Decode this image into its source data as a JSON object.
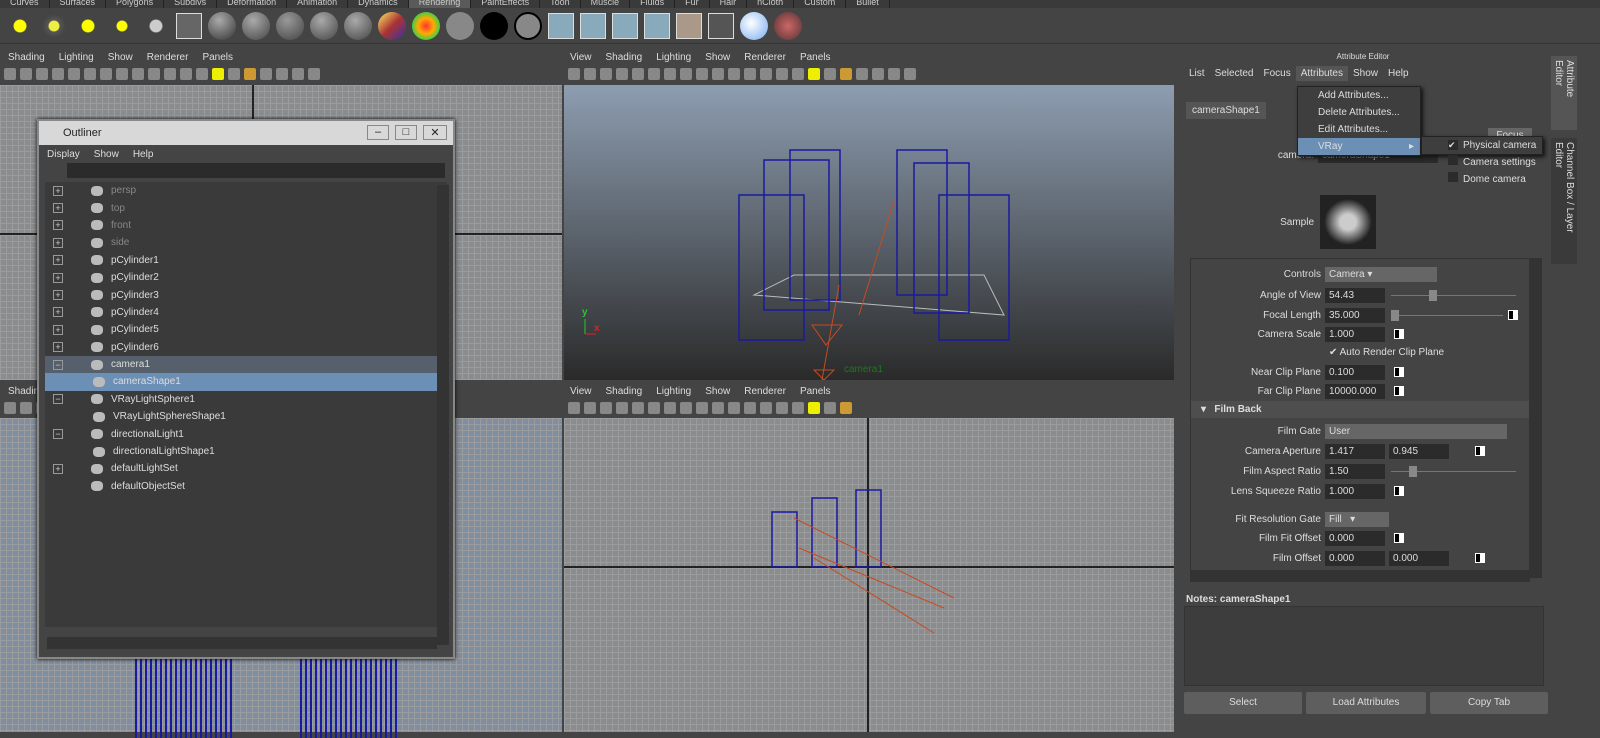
{
  "shelf_tabs": [
    "Curves",
    "Surfaces",
    "Polygons",
    "Subdivs",
    "Deformation",
    "Animation",
    "Dynamics",
    "Rendering",
    "PaintEffects",
    "Toon",
    "Muscle",
    "Fluids",
    "Fur",
    "Hair",
    "nCloth",
    "Custom",
    "Bullet"
  ],
  "active_shelf": "Rendering",
  "panel_menu": [
    "View",
    "Shading",
    "Lighting",
    "Show",
    "Renderer",
    "Panels"
  ],
  "left_panel_menu": [
    "Shading",
    "Lighting",
    "Show",
    "Renderer",
    "Panels"
  ],
  "viewport": {
    "camera_label": "camera1",
    "axis_y": "y",
    "axis_x": "x"
  },
  "outliner": {
    "title": "Outliner",
    "menu": [
      "Display",
      "Show",
      "Help"
    ],
    "items": [
      {
        "label": "persp",
        "dim": true,
        "expand": "+"
      },
      {
        "label": "top",
        "dim": true,
        "expand": "+"
      },
      {
        "label": "front",
        "dim": true,
        "expand": "+"
      },
      {
        "label": "side",
        "dim": true,
        "expand": "+"
      },
      {
        "label": "pCylinder1",
        "expand": "+"
      },
      {
        "label": "pCylinder2",
        "expand": "+"
      },
      {
        "label": "pCylinder3",
        "expand": "+"
      },
      {
        "label": "pCylinder4",
        "expand": "+"
      },
      {
        "label": "pCylinder5",
        "expand": "+"
      },
      {
        "label": "pCylinder6",
        "expand": "+"
      },
      {
        "label": "camera1",
        "expand": "−",
        "selected": "parent"
      },
      {
        "label": "cameraShape1",
        "child": true,
        "selected": "yes"
      },
      {
        "label": "VRayLightSphere1",
        "expand": "−"
      },
      {
        "label": "VRayLightSphereShape1",
        "child": true
      },
      {
        "label": "directionalLight1",
        "expand": "−"
      },
      {
        "label": "directionalLightShape1",
        "child": true
      },
      {
        "label": "defaultLightSet",
        "expand": "+"
      },
      {
        "label": "defaultObjectSet",
        "expand": ""
      }
    ]
  },
  "attribute_editor": {
    "title": "Attribute Editor",
    "menu": [
      "List",
      "Selected",
      "Focus",
      "Attributes",
      "Show",
      "Help"
    ],
    "tab": "cameraShape1",
    "focus_button": "Focus",
    "camera_label": "camera:",
    "camera_value": "cameraShape1",
    "sample_label": "Sample",
    "attributes_menu": [
      "Add Attributes...",
      "Delete Attributes...",
      "Edit Attributes...",
      "VRay"
    ],
    "vray_submenu": [
      {
        "label": "Physical camera",
        "checked": true
      },
      {
        "label": "Camera settings",
        "checked": false
      },
      {
        "label": "Dome camera",
        "checked": false
      }
    ],
    "controls_label": "Controls",
    "controls_value": "Camera",
    "angle_of_view_label": "Angle of View",
    "angle_of_view": "54.43",
    "focal_length_label": "Focal Length",
    "focal_length": "35.000",
    "camera_scale_label": "Camera Scale",
    "camera_scale": "1.000",
    "auto_render_clip_label": "Auto Render Clip Plane",
    "auto_render_clip": true,
    "near_clip_label": "Near Clip Plane",
    "near_clip": "0.100",
    "far_clip_label": "Far Clip Plane",
    "far_clip": "10000.000",
    "film_back_section": "Film Back",
    "film_gate_label": "Film Gate",
    "film_gate": "User",
    "camera_aperture_label": "Camera Aperture",
    "camera_aperture": [
      "1.417",
      "0.945"
    ],
    "film_aspect_label": "Film Aspect Ratio",
    "film_aspect": "1.50",
    "lens_squeeze_label": "Lens Squeeze Ratio",
    "lens_squeeze": "1.000",
    "fit_res_gate_label": "Fit Resolution Gate",
    "fit_res_gate": "Fill",
    "film_fit_offset_label": "Film Fit Offset",
    "film_fit_offset": "0.000",
    "film_offset_label": "Film Offset",
    "film_offset": [
      "0.000",
      "0.000"
    ],
    "notes_label": "Notes:  cameraShape1",
    "buttons": {
      "select": "Select",
      "load": "Load Attributes",
      "copy": "Copy Tab"
    },
    "side_tabs": [
      "Attribute Editor",
      "Channel Box / Layer Editor"
    ]
  },
  "colors": {
    "wire": "#1a1aa0",
    "camera": "#c84a20",
    "selection": "#6b8fb5"
  }
}
